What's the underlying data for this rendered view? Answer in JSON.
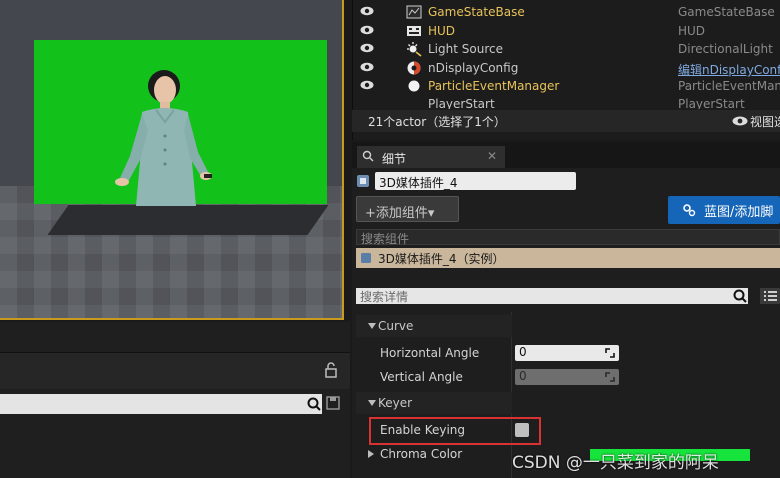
{
  "outliner": {
    "rows": [
      {
        "name": "GameStateBase",
        "type": "GameStateBase",
        "icon": "game-state-icon",
        "name_color": "#e8c35a"
      },
      {
        "name": "HUD",
        "type": "HUD",
        "icon": "hud-icon",
        "name_color": "#e8c35a"
      },
      {
        "name": "Light Source",
        "type": "DirectionalLight",
        "icon": "directional-light-icon",
        "name_color": "#c8c8c8"
      },
      {
        "name": "nDisplayConfig",
        "type": "编辑nDisplayConfig",
        "icon": "ndisplay-icon",
        "name_color": "#c8c8c8"
      },
      {
        "name": "ParticleEventManager",
        "type": "ParticleEventManager",
        "icon": "particle-manager-icon",
        "name_color": "#e8c35a"
      },
      {
        "name": "PlayerStart",
        "type": "PlayerStart",
        "icon": "player-start-icon",
        "name_color": "#c8c8c8"
      }
    ],
    "status": "21个actor（选择了1个）",
    "view_options": "视图选"
  },
  "details": {
    "tab_label": "细节",
    "object_name": "3D媒体插件_4",
    "add_component": "添加组件",
    "blueprint_button": "蓝图/添加脚",
    "component_search_placeholder": "搜索组件",
    "instance_row": "3D媒体插件_4（实例）",
    "property_search_placeholder": "搜索详情",
    "categories": {
      "curve": "Curve",
      "keyer": "Keyer"
    },
    "properties": {
      "horizontal_angle": {
        "label": "Horizontal Angle",
        "value": "0"
      },
      "vertical_angle": {
        "label": "Vertical Angle",
        "value": "0"
      },
      "enable_keying": {
        "label": "Enable Keying",
        "checked": false
      },
      "chroma_color": {
        "label": "Chroma Color",
        "color": "#16e43c"
      }
    }
  },
  "colors": {
    "accent_blue": "#1565b8",
    "selection_tan": "#c9b69b",
    "viewport_border": "#c89a1e",
    "green_screen": "#12c21b",
    "highlight_red": "#d83232"
  },
  "watermark": "CSDN @一只菜到家的阿呆"
}
